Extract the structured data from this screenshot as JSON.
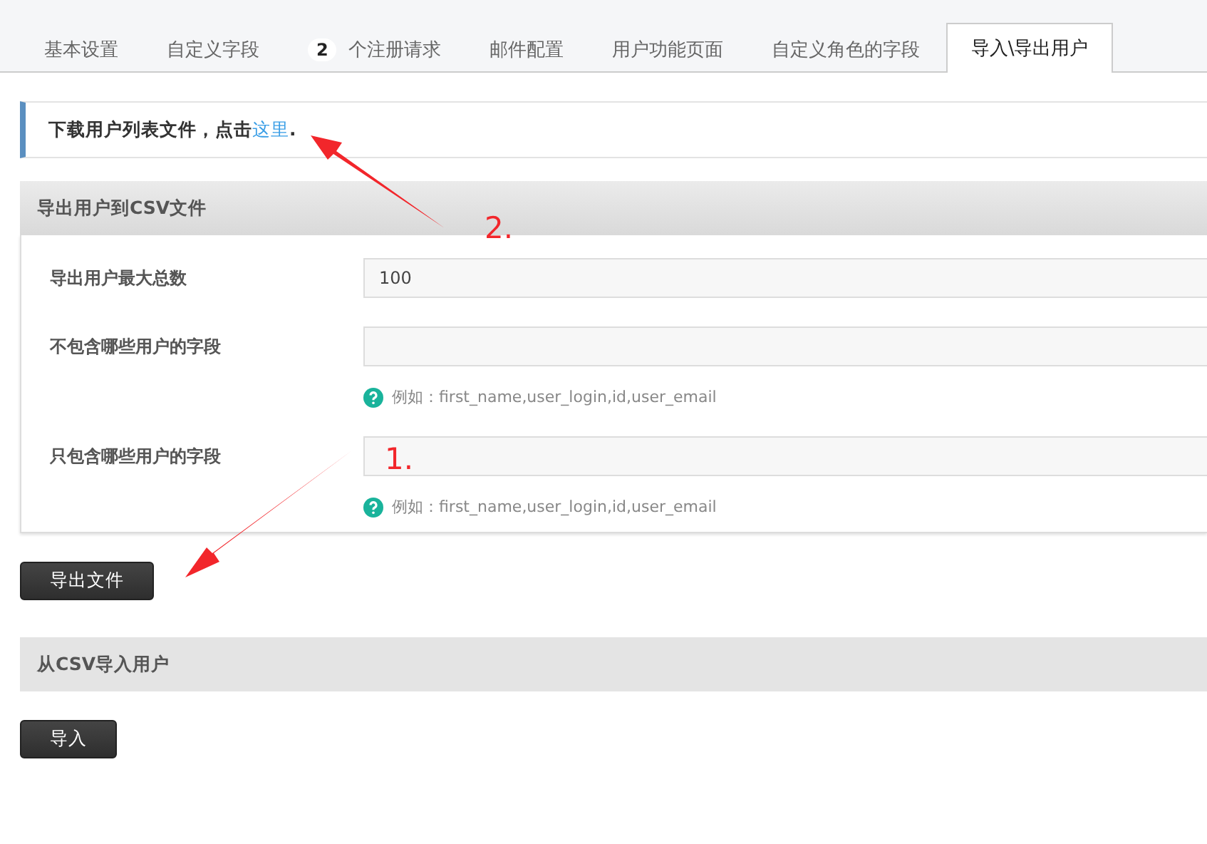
{
  "tabs": [
    {
      "label": "基本设置",
      "selected": false
    },
    {
      "label": "自定义字段",
      "selected": false
    },
    {
      "label": "个注册请求",
      "count": "2",
      "selected": false
    },
    {
      "label": "邮件配置",
      "selected": false
    },
    {
      "label": "用户功能页面",
      "selected": false
    },
    {
      "label": "自定义角色的字段",
      "selected": false
    },
    {
      "label": "导入\\导出用户",
      "selected": true
    }
  ],
  "notice": {
    "text": "下载用户列表文件，点击",
    "link": "这里",
    "suffix": "."
  },
  "export_section": {
    "title": "导出用户到CSV文件",
    "fields": [
      {
        "label": "导出用户最大总数",
        "value": "100"
      },
      {
        "label": "不包含哪些用户的字段",
        "help": "例如：first_name,user_login,id,user_email"
      },
      {
        "label": "只包含哪些用户的字段",
        "help": "例如：first_name,user_login,id,user_email"
      }
    ],
    "button": "导出文件"
  },
  "import_section": {
    "title": "从CSV导入用户",
    "button": "导入"
  },
  "annotations": [
    {
      "label": "2."
    },
    {
      "label": "1."
    }
  ]
}
